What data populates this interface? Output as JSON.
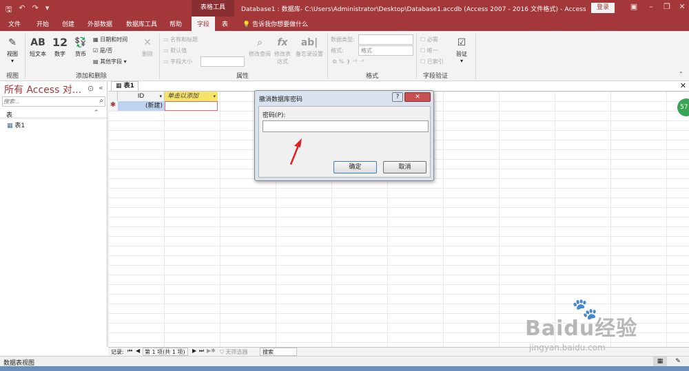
{
  "window": {
    "title": "Database1 : 数据库- C:\\Users\\Administrator\\Desktop\\Database1.accdb (Access 2007 - 2016 文件格式) - Access",
    "context_tools": "表格工具",
    "login": "登录"
  },
  "tabs": [
    "文件",
    "开始",
    "创建",
    "外部数据",
    "数据库工具",
    "帮助",
    "字段",
    "表"
  ],
  "active_tab": "字段",
  "tell_me": "告诉我你想要做什么",
  "ribbon": {
    "view": "视图",
    "short_text": "短文本",
    "number": "数字",
    "currency": "货币",
    "datetime": "日期和时间",
    "yesno": "是/否",
    "more_fields": "其他字段",
    "delete": "删除",
    "name_caption": "名称和标题",
    "default_value": "默认值",
    "field_size": "字段大小",
    "modify_lookups": "修改查阅",
    "modify_expression": "修改表达式",
    "memo_settings": "备忘录设置",
    "data_type_label": "数据类型:",
    "format_label": "格式:",
    "format_value": "格式",
    "required": "必需",
    "unique": "唯一",
    "indexed": "已索引",
    "validation": "验证",
    "groups": [
      "视图",
      "添加和删除",
      "属性",
      "格式",
      "字段验证"
    ]
  },
  "nav": {
    "title": "所有 Access 对...",
    "search_placeholder": "搜索...",
    "section": "表",
    "items": [
      "表1"
    ]
  },
  "doc": {
    "tab": "表1",
    "col_id": "ID",
    "col_add": "单击以添加",
    "new_row": "(新建)"
  },
  "dialog": {
    "title": "撤消数据库密码",
    "label": "密码(P):",
    "ok": "确定",
    "cancel": "取消"
  },
  "recordbar": {
    "label": "记录:",
    "position": "第 1 项(共 1 项)",
    "filter": "无筛选器",
    "search": "搜索"
  },
  "status": "数据表视图",
  "watermark": {
    "brand": "Baidu经验",
    "url": "jingyan.baidu.com"
  }
}
